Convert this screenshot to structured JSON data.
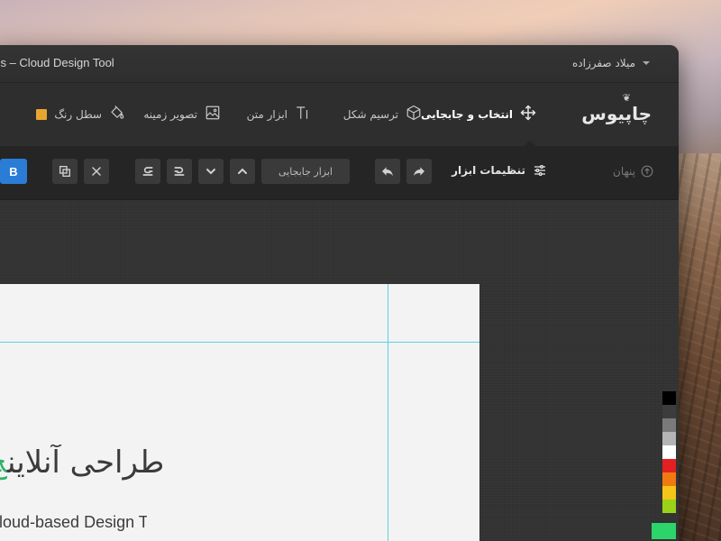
{
  "window": {
    "title": "oos – Cloud Design Tool",
    "user_name": "میلاد صفرزاده"
  },
  "toolbar": {
    "logo": "چاپیوس",
    "tools": [
      {
        "label": "انتخاب و جابجایی",
        "icon": "move-icon",
        "active": true
      },
      {
        "label": "ترسیم شکل",
        "icon": "cube-icon",
        "active": false
      },
      {
        "label": "ابزار متن",
        "icon": "text-icon",
        "active": false
      },
      {
        "label": "تصویر زمینه",
        "icon": "image-icon",
        "active": false
      },
      {
        "label": "سطل رنگ",
        "icon": "paint-bucket-icon",
        "active": false,
        "swatch_color": "#e8a631"
      }
    ]
  },
  "options": {
    "hide_label": "پنهان",
    "settings_label": "تنظیمات ابزار",
    "select_value": "ابزار جابجایی",
    "bold_label": "B"
  },
  "canvas": {
    "headline": "طراحی آنلاین",
    "headline_accent": "چ",
    "subline": "Cloud-based Design Tool"
  },
  "palette": {
    "colors": [
      "#000000",
      "#3c3c3c",
      "#7a7a7a",
      "#b4b4b4",
      "#ffffff",
      "#e32020",
      "#f07a10",
      "#f5c518",
      "#9ad21a",
      "#2bd56a"
    ]
  },
  "colors": {
    "accent": "#2a7cd6",
    "guide": "#5bd1e3",
    "headline_accent": "#2fb36b"
  }
}
